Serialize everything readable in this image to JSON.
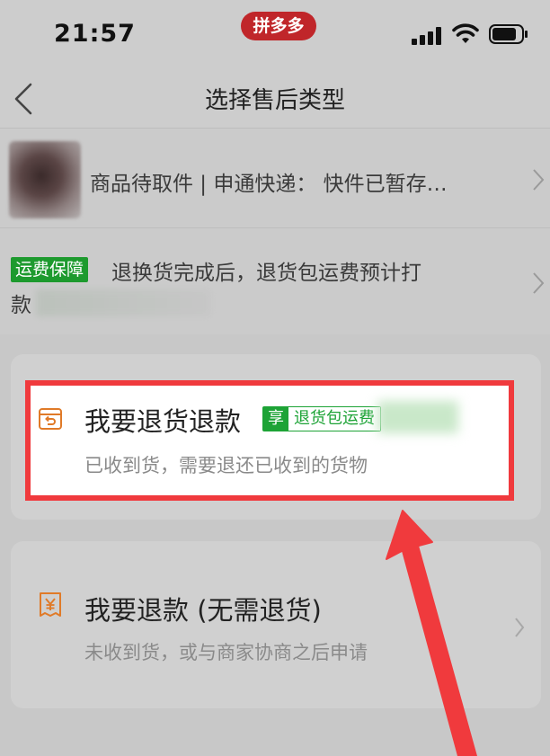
{
  "status_bar": {
    "time": "21:57",
    "app_badge": "拼多多"
  },
  "nav": {
    "title": "选择售后类型"
  },
  "order": {
    "status_text": "商品待取件 | 申通快递：  快件已暂存…"
  },
  "shipping": {
    "badge": "运费保障",
    "line1": "退换货完成后，退货包运费预计打",
    "line2": "款"
  },
  "options": [
    {
      "title": "我要退货退款",
      "badge_prefix": "享",
      "badge_text": "退货包运费",
      "subtitle": "已收到货，需要退还已收到的货物",
      "icon": "return-box-icon"
    },
    {
      "title": "我要退款 (无需退货)",
      "subtitle": "未收到货，或与商家协商之后申请",
      "icon": "yen-refund-icon"
    }
  ],
  "colors": {
    "highlight_border": "#f03a3d",
    "badge_green": "#1da336",
    "icon_orange": "#e07a28",
    "pill_red": "#c0262a"
  }
}
